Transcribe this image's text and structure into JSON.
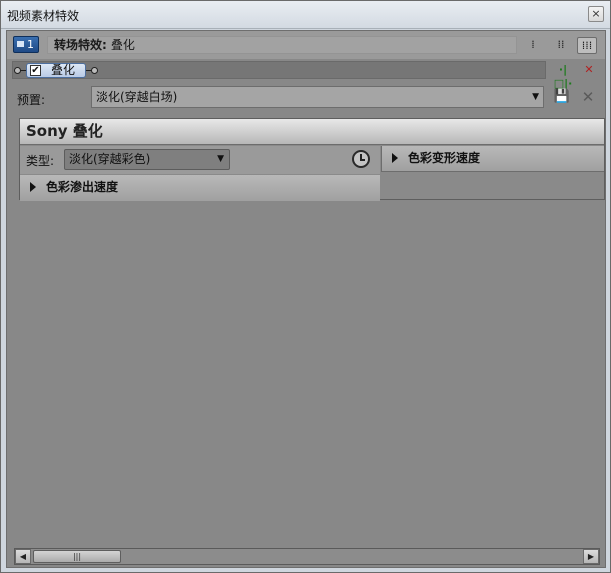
{
  "window": {
    "title": "视频素材特效",
    "close_icon": "×"
  },
  "header": {
    "track_number": "1",
    "label": "转场特效:",
    "value": "叠化",
    "view_buttons": [
      "⁞",
      "⁞⁞",
      "⁞⁞⁞"
    ]
  },
  "chain": {
    "effect_name": "叠化",
    "checked": true,
    "check_glyph": "✔"
  },
  "plugin_buttons": {
    "plugin_chain_icon": "·|□|·",
    "remove_plugin_icon": "✕"
  },
  "preset": {
    "label": "预置:",
    "value": "淡化(穿越白场)",
    "arrow": "▼",
    "save_icon": "💾",
    "delete_icon": "✕"
  },
  "panel": {
    "title": "Sony 叠化",
    "type_label": "类型:",
    "type_value": "淡化(穿越彩色)",
    "type_arrow": "▼",
    "section_right": "色彩变形速度",
    "section_left": "色彩渗出速度"
  },
  "scrollbar": {
    "left_arrow": "◀",
    "right_arrow": "▶",
    "thumb_grip": "|||"
  }
}
